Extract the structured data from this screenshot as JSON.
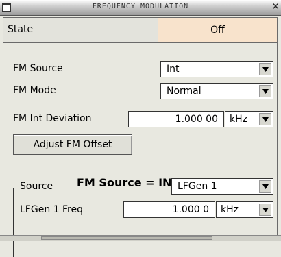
{
  "window": {
    "title": "FREQUENCY MODULATION"
  },
  "state": {
    "label": "State",
    "value": "Off"
  },
  "fm_source": {
    "label": "FM Source",
    "value": "Int"
  },
  "fm_mode": {
    "label": "FM Mode",
    "value": "Normal"
  },
  "fm_int_deviation": {
    "label": "FM Int Deviation",
    "value": "1.000 00",
    "unit": "kHz"
  },
  "adjust_button": {
    "label": "Adjust FM Offset"
  },
  "internal_group": {
    "title": "FM Source = INTernal",
    "source": {
      "label": "Source",
      "value": "LFGen 1"
    },
    "lfgen_freq": {
      "label": "LFGen 1 Freq",
      "value": "1.000 0",
      "unit": "kHz"
    }
  },
  "colors": {
    "state_off_bg": "#f8e3cc",
    "panel_bg": "#e8e8e0"
  },
  "icons": [
    "window-menu-icon",
    "close-icon",
    "dropdown-arrow-icon"
  ]
}
